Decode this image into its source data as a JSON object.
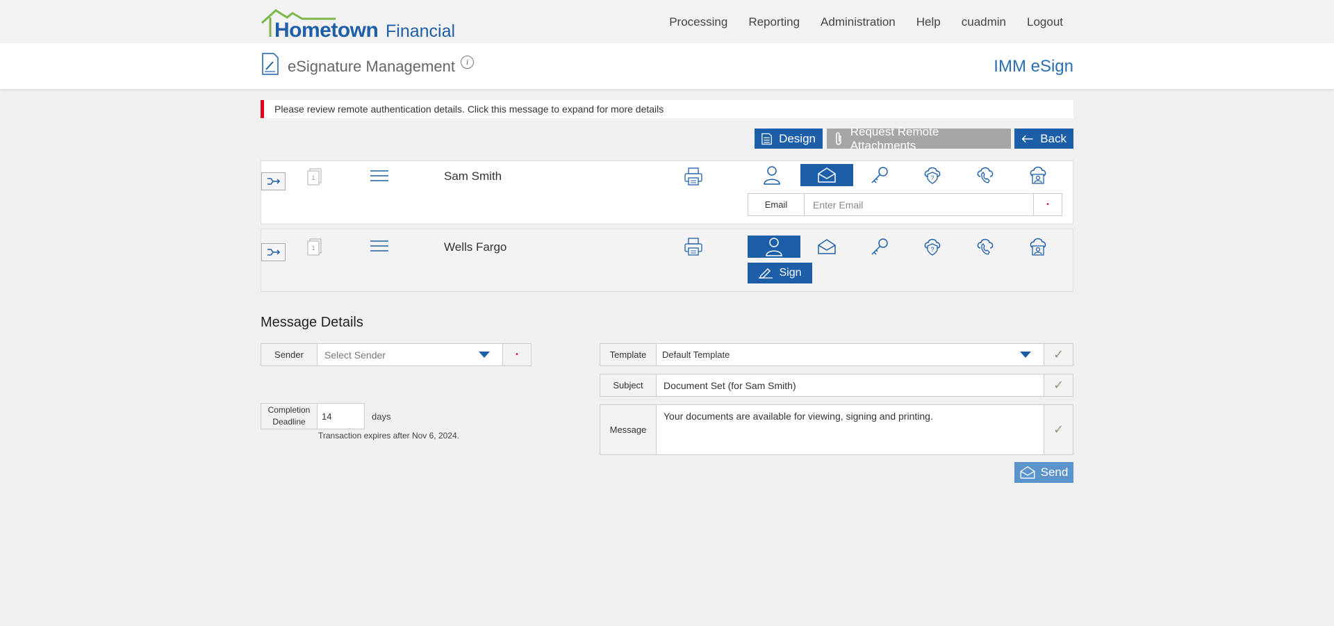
{
  "brand": {
    "name_bold": "Hometown",
    "name_light": "Financial"
  },
  "nav": [
    "Processing",
    "Reporting",
    "Administration",
    "Help",
    "cuadmin",
    "Logout"
  ],
  "header": {
    "title": "eSignature Management",
    "info": "i",
    "product": "IMM eSign"
  },
  "alert": "Please review remote authentication details. Click this message to expand for more details",
  "actions": {
    "design": "Design",
    "attachments": "Request Remote Attachments",
    "back": "Back"
  },
  "signers": [
    {
      "name": "Sam Smith",
      "page_number": "1",
      "active_auth": "email-icon",
      "email": {
        "label": "Email",
        "value": "",
        "placeholder": "Enter Email",
        "required_mark": "•"
      }
    },
    {
      "name": "Wells Fargo",
      "page_number": "1",
      "active_auth": "person-icon",
      "sign_label": "Sign"
    }
  ],
  "auth_icons": [
    "person-icon",
    "email-icon",
    "key-icon",
    "cloud-question-icon",
    "cloud-phone-icon",
    "cloud-id-icon"
  ],
  "message_details": {
    "title": "Message Details",
    "sender": {
      "label": "Sender",
      "placeholder": "Select Sender",
      "required_mark": "•"
    },
    "completion": {
      "label": "Completion Deadline",
      "value": "14",
      "unit": "days",
      "expires": "Transaction expires after Nov 6, 2024."
    },
    "template": {
      "label": "Template",
      "value": "Default Template"
    },
    "subject": {
      "label": "Subject",
      "value": "Document Set (for Sam Smith)"
    },
    "message": {
      "label": "Message",
      "value": "Your documents are available for viewing, signing and printing."
    },
    "check_mark": "✓",
    "send": "Send"
  },
  "colors": {
    "primary": "#1c5ea8",
    "accent_red": "#e1001a",
    "send_disabled": "#5b94cb",
    "logo_green": "#7ab648"
  }
}
